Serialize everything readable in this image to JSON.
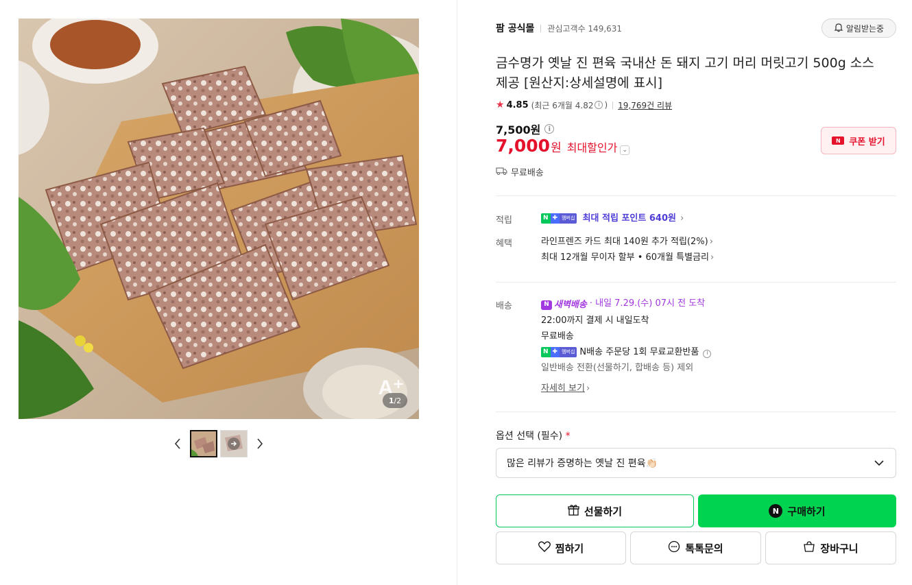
{
  "gallery": {
    "page_current": "1",
    "page_total": "/2",
    "watermark": "A⁺"
  },
  "store": {
    "name": "팜 공식몰",
    "fans": "관심고객수 149,631",
    "notify_label": "알림받는중"
  },
  "product": {
    "title": "금수명가 옛날 진 편육 국내산 돈 돼지 고기 머리 머릿고기 500g 소스 제공 [원산지:상세설명에 표시]",
    "rating": "4.85",
    "rating_recent_prefix": "(최근 6개월 4.82",
    "rating_recent_suffix": ")",
    "review_count": "19,769건 리뷰",
    "original_price": "7,500원",
    "sale_price": "7,000",
    "sale_unit": "원",
    "sale_label": "최대할인가",
    "coupon_label": "쿠폰 받기",
    "shipping_free": "무료배송"
  },
  "benefits": {
    "points_label": "적립",
    "member_badge_n": "N",
    "member_badge_plus": "✚",
    "member_badge_text": "멤버십",
    "points_text": "최대 적립 포인트 640원",
    "benefit_label": "혜택",
    "benefit_line1": "라인프렌즈 카드 최대 140원 추가 적립(2%)",
    "benefit_line2": "최대 12개월 무이자 할부 • 60개월 특별금리"
  },
  "delivery": {
    "label": "배송",
    "dawn_badge": "새벽배송",
    "dawn_eta": "· 내일 7.29.(수) 07시 전 도착",
    "line2": "22:00까지 결제 시 내일도착",
    "line3": "무료배송",
    "line4": "N배송 주문당 1회 무료교환반품",
    "line5": "일반배송 전환(선물하기, 합배송 등) 제외",
    "detail_link": "자세히 보기"
  },
  "option": {
    "label": "옵션 선택 (필수)",
    "required_mark": "*",
    "selected": "많은 리뷰가 증명하는 옛날 진 편육👏🏻"
  },
  "actions": {
    "gift": "선물하기",
    "buy": "구매하기",
    "buy_n": "N",
    "wish": "찜하기",
    "talk": "톡톡문의",
    "cart": "장바구니"
  },
  "colors": {
    "sale_red": "#e5122c",
    "naver_green": "#03c75a",
    "point_purple": "#4e3dd6",
    "dawn_purple": "#a238e0"
  }
}
